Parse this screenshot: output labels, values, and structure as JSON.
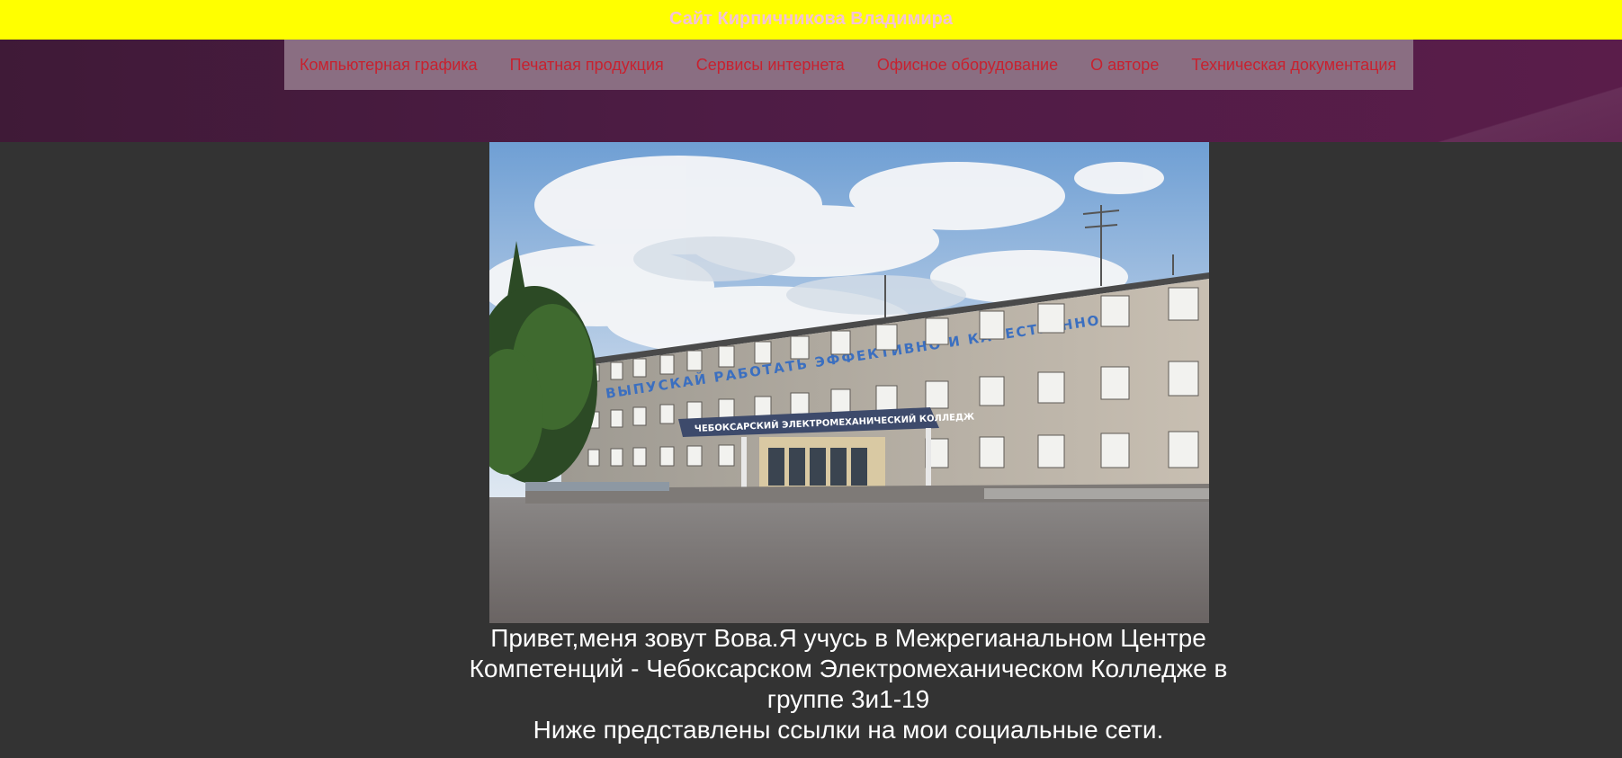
{
  "site": {
    "title": "Сайт Кирпичникова Владимира"
  },
  "nav": {
    "items": [
      {
        "label": "Компьютерная графика"
      },
      {
        "label": "Печатная продукция"
      },
      {
        "label": "Сервисы интернета"
      },
      {
        "label": "Офисное оборудование"
      },
      {
        "label": "О авторе"
      },
      {
        "label": "Техническая документация"
      }
    ]
  },
  "photo": {
    "sign_top": "ВЫПУСКАЙ РАБОТАТЬ ЭФФЕКТИВНО И КАЧЕСТВЕННО",
    "sign_entrance": "ЧЕБОКСАРСКИЙ ЭЛЕКТРОМЕХАНИЧЕСКИЙ КОЛЛЕДЖ"
  },
  "intro": {
    "line1": "Привет,меня зовут Вова.Я учусь в Межрегианальном Центре Компетенций - Чебоксарском Электромеханическом Колледже в группе 3и1-19",
    "line2": "Ниже представлены ссылки на мои социальные сети."
  },
  "colors": {
    "banner": "#ffff00",
    "title": "#f4c2d6",
    "nav_bg": "#8a6e82",
    "nav_text": "#c8212f",
    "header_band": "#4e1c45",
    "page_bg": "#333333"
  }
}
